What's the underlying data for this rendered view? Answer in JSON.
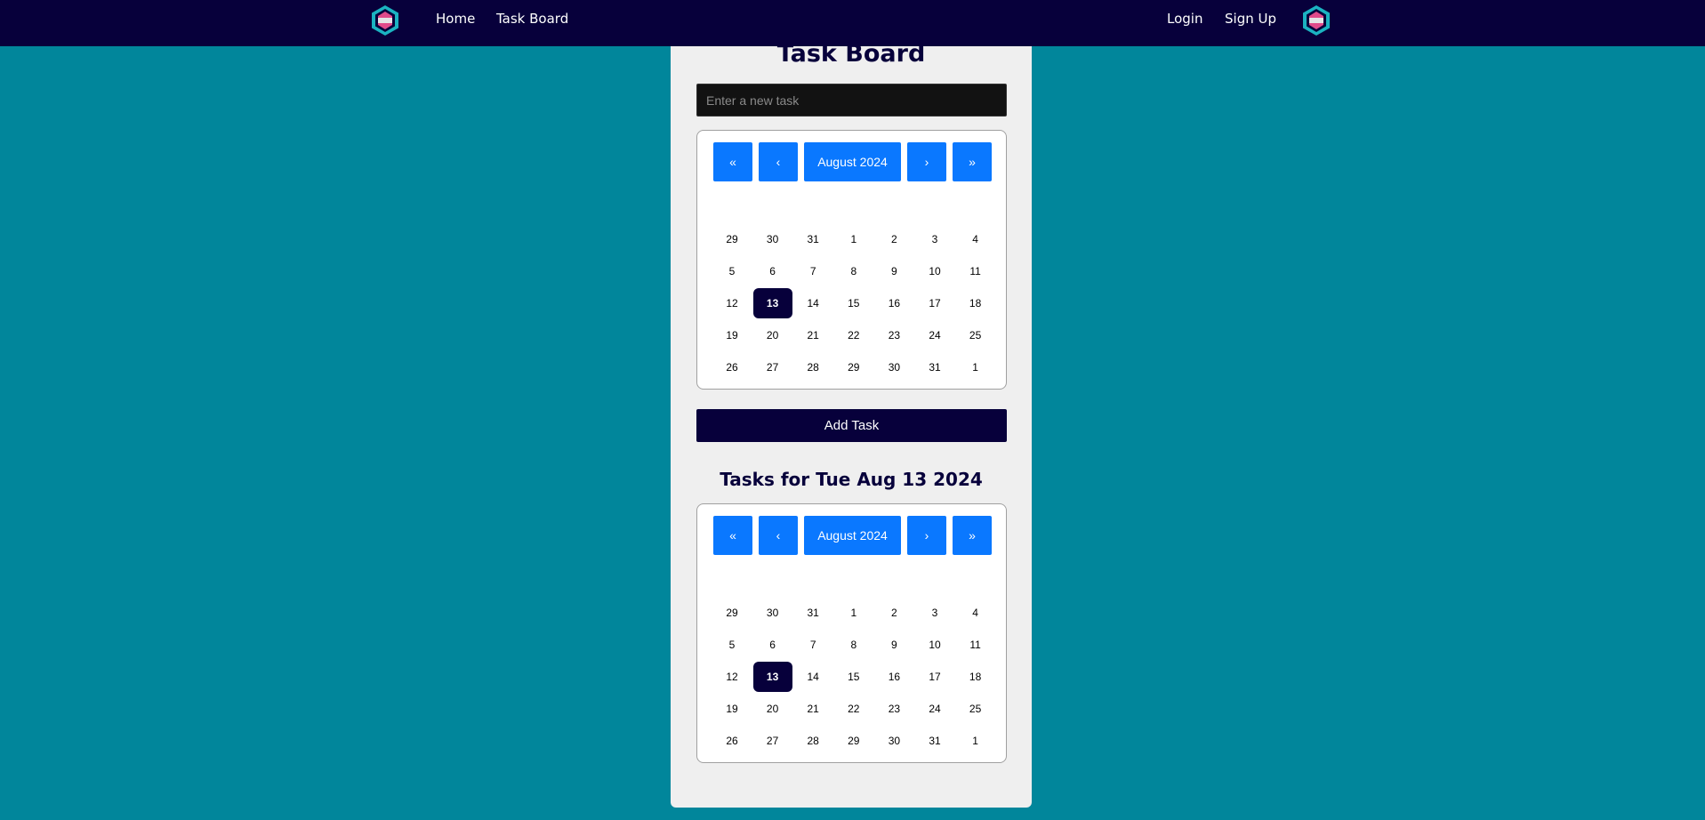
{
  "nav": {
    "home": "Home",
    "task_board": "Task Board",
    "login": "Login",
    "sign_up": "Sign Up"
  },
  "page": {
    "title": "Task Board",
    "input_placeholder": "Enter a new task",
    "add_task": "Add Task",
    "tasks_heading": "Tasks for Tue Aug 13 2024"
  },
  "calendar": {
    "first": "«",
    "prev": "‹",
    "label": "August 2024",
    "next": "›",
    "last": "»",
    "selected": "13",
    "weeks": [
      [
        "29",
        "30",
        "31",
        "1",
        "2",
        "3",
        "4"
      ],
      [
        "5",
        "6",
        "7",
        "8",
        "9",
        "10",
        "11"
      ],
      [
        "12",
        "13",
        "14",
        "15",
        "16",
        "17",
        "18"
      ],
      [
        "19",
        "20",
        "21",
        "22",
        "23",
        "24",
        "25"
      ],
      [
        "26",
        "27",
        "28",
        "29",
        "30",
        "31",
        "1"
      ]
    ]
  },
  "colors": {
    "navbar": "#07003b",
    "background": "#01869b",
    "accent": "#0a78ff",
    "selected_day": "#07003b"
  },
  "icons": {
    "logo": "hexagon-logo-icon"
  }
}
